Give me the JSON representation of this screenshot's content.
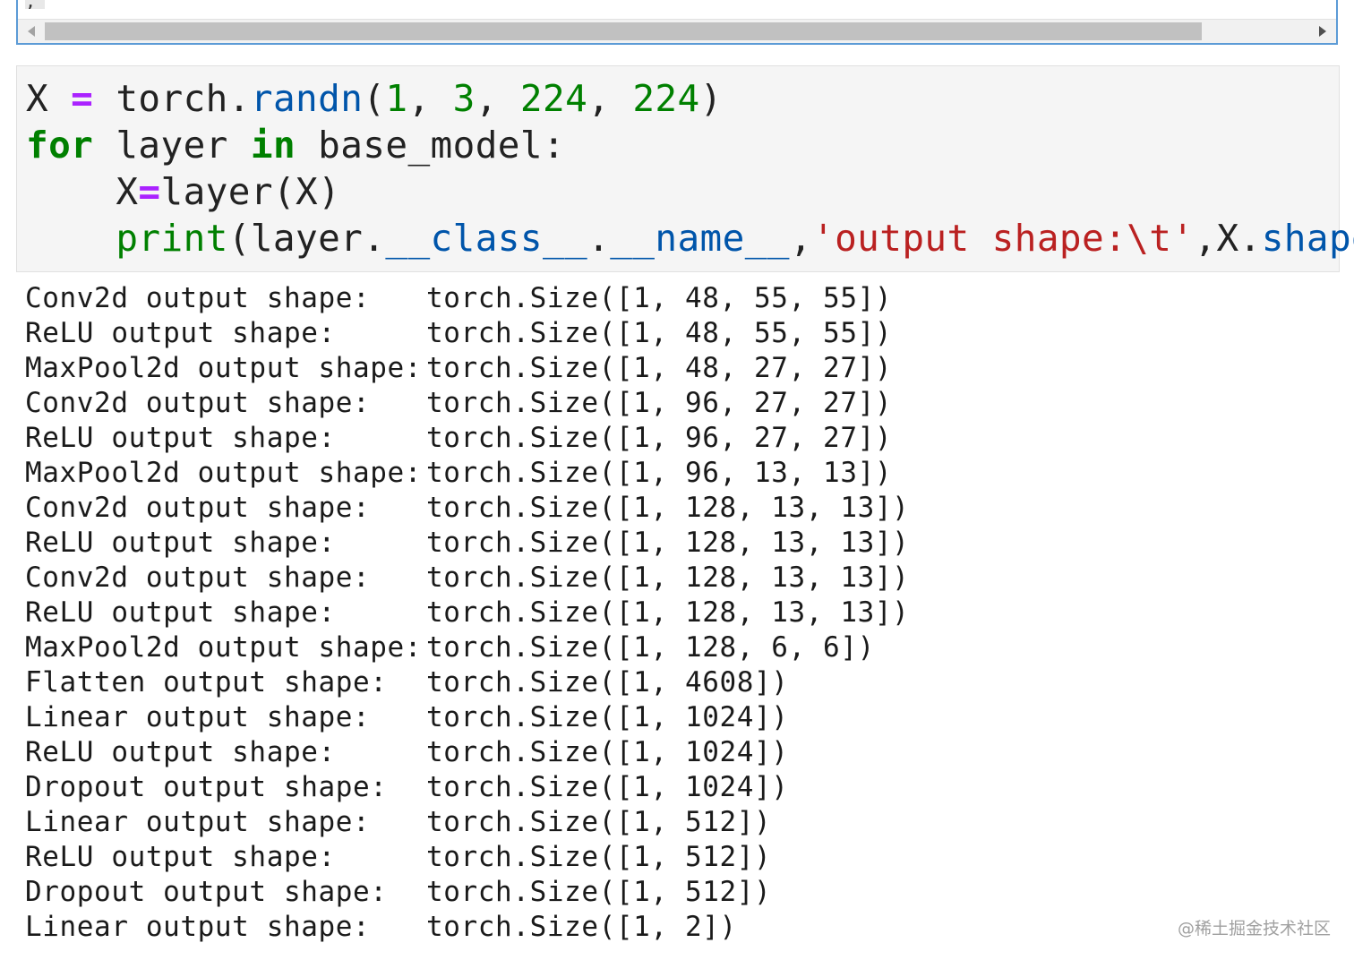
{
  "previous_cell": {
    "visible_char": ","
  },
  "code_cell": {
    "lines": [
      [
        {
          "t": "X ",
          "c": "plain"
        },
        {
          "t": "=",
          "c": "op"
        },
        {
          "t": " torch.",
          "c": "plain"
        },
        {
          "t": "randn",
          "c": "fn"
        },
        {
          "t": "(",
          "c": "plain"
        },
        {
          "t": "1",
          "c": "num"
        },
        {
          "t": ", ",
          "c": "plain"
        },
        {
          "t": "3",
          "c": "num"
        },
        {
          "t": ", ",
          "c": "plain"
        },
        {
          "t": "224",
          "c": "num"
        },
        {
          "t": ", ",
          "c": "plain"
        },
        {
          "t": "224",
          "c": "num"
        },
        {
          "t": ")",
          "c": "plain"
        }
      ],
      [
        {
          "t": "for",
          "c": "kw"
        },
        {
          "t": " layer ",
          "c": "plain"
        },
        {
          "t": "in",
          "c": "kw"
        },
        {
          "t": " base_model:",
          "c": "plain"
        }
      ],
      [
        {
          "t": "    X",
          "c": "plain"
        },
        {
          "t": "=",
          "c": "op"
        },
        {
          "t": "layer(X)",
          "c": "plain"
        }
      ],
      [
        {
          "t": "    ",
          "c": "plain"
        },
        {
          "t": "print",
          "c": "bi"
        },
        {
          "t": "(layer.",
          "c": "plain"
        },
        {
          "t": "__class__",
          "c": "attr"
        },
        {
          "t": ".",
          "c": "plain"
        },
        {
          "t": "__name__",
          "c": "attr"
        },
        {
          "t": ",",
          "c": "plain"
        },
        {
          "t": "'output shape:\\t'",
          "c": "str"
        },
        {
          "t": ",X.",
          "c": "plain"
        },
        {
          "t": "shape",
          "c": "attr"
        },
        {
          "t": ")",
          "c": "plain"
        }
      ]
    ]
  },
  "output": {
    "rows": [
      {
        "label": "Conv2d output shape:",
        "value": "torch.Size([1, 48, 55, 55])"
      },
      {
        "label": "ReLU output shape:",
        "value": "torch.Size([1, 48, 55, 55])"
      },
      {
        "label": "MaxPool2d output shape:",
        "value": "torch.Size([1, 48, 27, 27])"
      },
      {
        "label": "Conv2d output shape:",
        "value": "torch.Size([1, 96, 27, 27])"
      },
      {
        "label": "ReLU output shape:",
        "value": "torch.Size([1, 96, 27, 27])"
      },
      {
        "label": "MaxPool2d output shape:",
        "value": "torch.Size([1, 96, 13, 13])"
      },
      {
        "label": "Conv2d output shape:",
        "value": "torch.Size([1, 128, 13, 13])"
      },
      {
        "label": "ReLU output shape:",
        "value": "torch.Size([1, 128, 13, 13])"
      },
      {
        "label": "Conv2d output shape:",
        "value": "torch.Size([1, 128, 13, 13])"
      },
      {
        "label": "ReLU output shape:",
        "value": "torch.Size([1, 128, 13, 13])"
      },
      {
        "label": "MaxPool2d output shape:",
        "value": "torch.Size([1, 128, 6, 6])"
      },
      {
        "label": "Flatten output shape:",
        "value": "torch.Size([1, 4608])"
      },
      {
        "label": "Linear output shape:",
        "value": "torch.Size([1, 1024])"
      },
      {
        "label": "ReLU output shape:",
        "value": "torch.Size([1, 1024])"
      },
      {
        "label": "Dropout output shape:",
        "value": "torch.Size([1, 1024])"
      },
      {
        "label": "Linear output shape:",
        "value": "torch.Size([1, 512])"
      },
      {
        "label": "ReLU output shape:",
        "value": "torch.Size([1, 512])"
      },
      {
        "label": "Dropout output shape:",
        "value": "torch.Size([1, 512])"
      },
      {
        "label": "Linear output shape:",
        "value": "torch.Size([1, 2])"
      }
    ]
  },
  "watermark": "@稀土掘金技术社区",
  "colors": {
    "cell_border_active": "#5c9bd6",
    "code_bg": "#f5f5f5",
    "keyword": "#008000",
    "operator": "#aa22ff",
    "function": "#0055aa",
    "string": "#ba2121"
  }
}
